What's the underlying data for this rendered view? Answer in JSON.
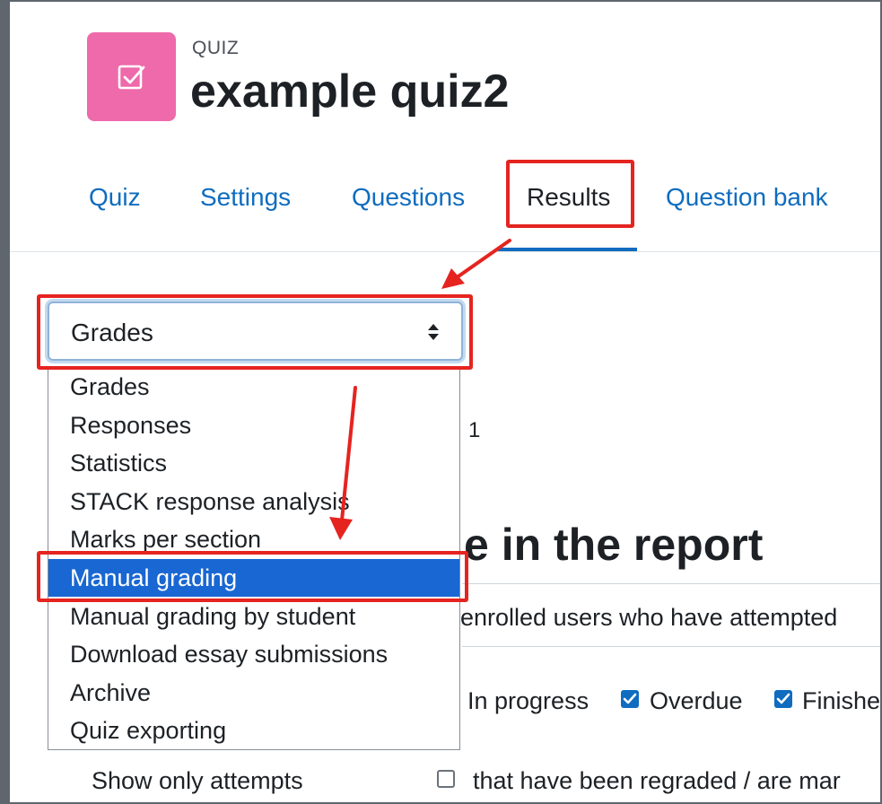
{
  "header": {
    "module_type": "QUIZ",
    "title": "example quiz2",
    "icon": "quiz-icon",
    "icon_color": "#ee6aaa"
  },
  "tabs": [
    {
      "label": "Quiz"
    },
    {
      "label": "Settings"
    },
    {
      "label": "Questions"
    },
    {
      "label": "Results",
      "active": true
    },
    {
      "label": "Question bank"
    }
  ],
  "report_select": {
    "value": "Grades",
    "options": [
      "Grades",
      "Responses",
      "Statistics",
      "STACK response analysis",
      "Marks per section",
      "Manual grading",
      "Manual grading by student",
      "Download essay submissions",
      "Archive",
      "Quiz exporting"
    ],
    "highlighted": "Manual grading"
  },
  "background": {
    "number_fragment": "1",
    "heading_fragment": "e in the report",
    "attempts_from_fragment": "enrolled users who have attempted",
    "states": [
      {
        "label": "In progress",
        "checked": null
      },
      {
        "label": "Overdue",
        "checked": true
      },
      {
        "label": "Finishe",
        "checked": true
      }
    ],
    "show_only_label": "Show only attempts",
    "regraded_label": "that have been regraded / are mar"
  },
  "colors": {
    "link": "#0f6cbf",
    "highlight": "#1967d2",
    "annotation": "#e52420"
  }
}
